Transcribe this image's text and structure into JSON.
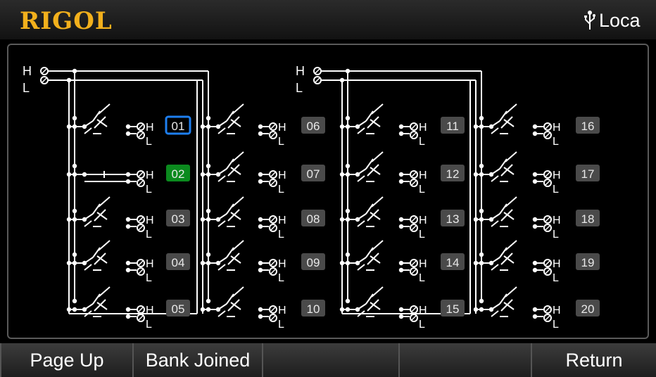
{
  "header": {
    "brand": "RIGOL",
    "brand_color": "#f2b01c",
    "usb_icon": "usb-icon",
    "status": "Loca"
  },
  "diagram": {
    "terminal_high": "H",
    "terminal_low": "L",
    "wire_color": "#ffffff",
    "selected_channel": "01",
    "selected_border_color": "#1e7ff0",
    "closed_channel": "02",
    "closed_color": "#0b8a1e",
    "channel_color": "#4a4a4a",
    "banks": [
      {
        "channels": [
          "01",
          "02",
          "03",
          "04",
          "05"
        ]
      },
      {
        "channels": [
          "06",
          "07",
          "08",
          "09",
          "10"
        ]
      },
      {
        "channels": [
          "11",
          "12",
          "13",
          "14",
          "15"
        ]
      },
      {
        "channels": [
          "16",
          "17",
          "18",
          "19",
          "20"
        ]
      }
    ]
  },
  "softkeys": [
    "Page Up",
    "Bank Joined",
    "",
    "",
    "Return"
  ]
}
